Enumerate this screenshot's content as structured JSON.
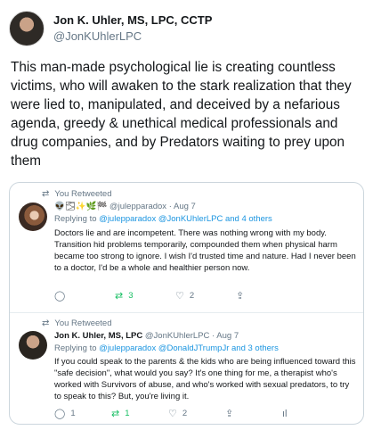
{
  "main_tweet": {
    "author_name": "Jon K. Uhler, MS, LPC, CCTP",
    "author_handle": "@JonKUhlerLPC",
    "text": "This man-made psychological lie is creating countless victims, who will awaken to the stark realization that they were lied to, manipulated, and deceived by a nefarious agenda, greedy & unethical medical professionals and drug companies, and by Predators waiting to prey upon them"
  },
  "replies": [
    {
      "retweeted_label": "You Retweeted",
      "display_name": "👽🌫✨🌿🏁",
      "handle": "@julepparadox",
      "date": "· Aug 7",
      "replying_prefix": "Replying to",
      "replying_mentions": "@julepparadox @JonKUhlerLPC",
      "replying_suffix": "and 4 others",
      "text": "Doctors lie and are incompetent. There was nothing wrong with my body. Transition hid problems temporarily, compounded them when physical harm became too strong to ignore. I wish I'd trusted time and nature. Had I never been to a doctor, I'd be a whole and healthier person now.",
      "actions": {
        "reply": "",
        "retweet": "3",
        "like": "2",
        "share": ""
      }
    },
    {
      "retweeted_label": "You Retweeted",
      "display_name": "Jon K. Uhler, MS, LPC",
      "handle": "@JonKUhlerLPC",
      "date": "· Aug 7",
      "replying_prefix": "Replying to",
      "replying_mentions": "@julepparadox @DonaldJTrumpJr",
      "replying_suffix": "and 3 others",
      "text": "If you could speak to the parents & the kids who are being influenced toward this \"safe decision\", what would you say? It's one thing for me, a therapist who's worked with Survivors of abuse, and who's worked with sexual predators, to try to speak to this? But, you're living it.",
      "actions": {
        "reply": "1",
        "retweet": "1",
        "like": "2",
        "share": ""
      }
    }
  ]
}
